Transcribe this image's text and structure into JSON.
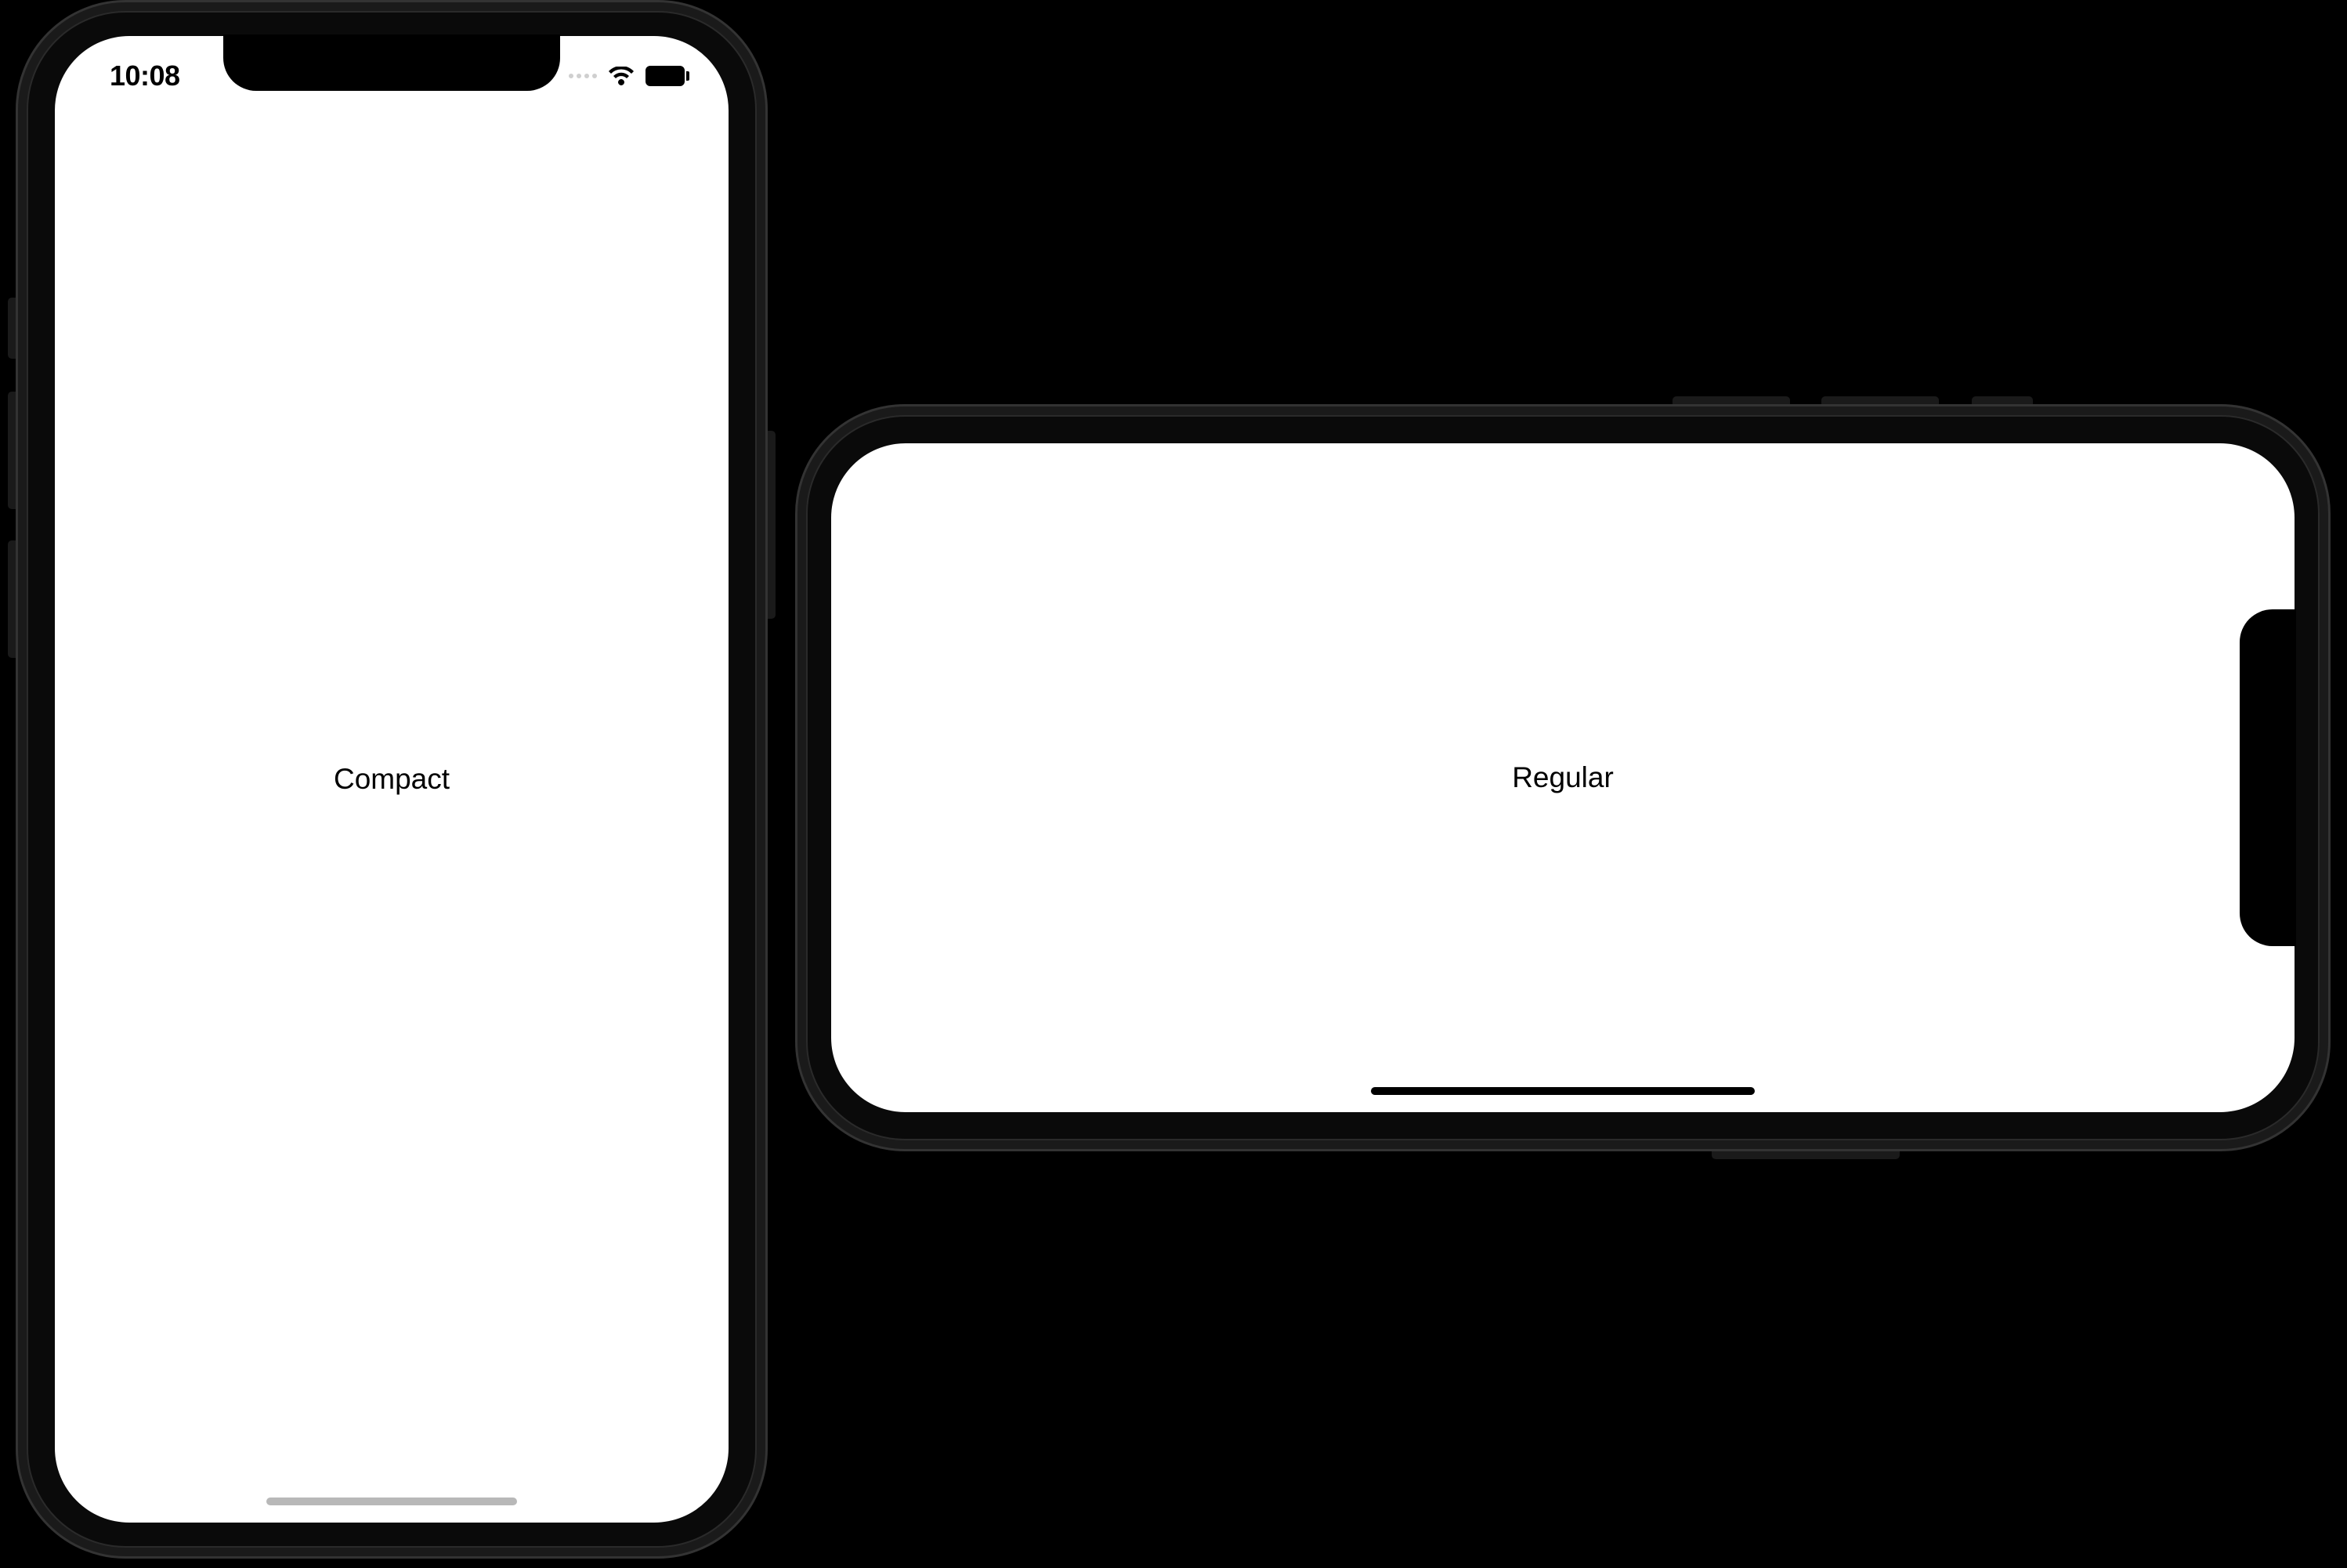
{
  "portrait": {
    "status_time": "10:08",
    "size_class_label": "Compact"
  },
  "landscape": {
    "size_class_label": "Regular"
  }
}
